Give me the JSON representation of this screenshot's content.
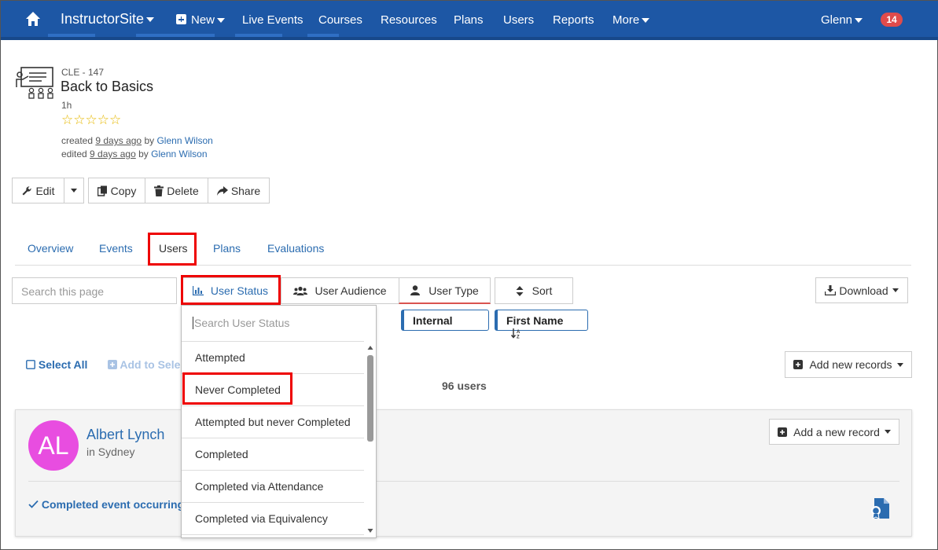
{
  "nav": {
    "brand": "InstructorSite",
    "new": "New",
    "items": [
      "Live Events",
      "Courses",
      "Resources",
      "Plans",
      "Users",
      "Reports",
      "More"
    ],
    "user": "Glenn",
    "badge": "14"
  },
  "course": {
    "code": "CLE - 147",
    "title": "Back to Basics",
    "duration": "1h",
    "stars": "☆☆☆☆☆",
    "created_prefix": "created",
    "created_when": "9 days ago",
    "created_by_word": "by",
    "created_by": "Glenn Wilson",
    "edited_prefix": "edited",
    "edited_when": "9 days ago",
    "edited_by_word": "by",
    "edited_by": "Glenn Wilson"
  },
  "actions": {
    "edit": "Edit",
    "copy": "Copy",
    "delete": "Delete",
    "share": "Share"
  },
  "tabs": [
    "Overview",
    "Events",
    "Users",
    "Plans",
    "Evaluations"
  ],
  "filters": {
    "search_placeholder": "Search this page",
    "user_status": "User Status",
    "user_audience": "User Audience",
    "user_type": "User Type",
    "sort": "Sort",
    "download": "Download",
    "chip_internal": "Internal",
    "chip_first_name": "First Name"
  },
  "dropdown": {
    "search_placeholder": "Search User Status",
    "items": [
      "Attempted",
      "Never Completed",
      "Attempted but never Completed",
      "Completed",
      "Completed via Attendance",
      "Completed via Equivalency"
    ]
  },
  "records": {
    "select_all": "Select All",
    "add_to_selection": "Add to Selec",
    "count": "96 users",
    "add_new_records": "Add new records"
  },
  "user_card": {
    "initials": "AL",
    "name": "Albert Lynch",
    "location": "in Sydney",
    "add_record": "Add a new record",
    "status": "Completed event occurring N"
  },
  "colors": {
    "nav": "#1d57a5",
    "accent": "#2b6cb0",
    "highlight": "#e00000",
    "avatar": "#e84de0",
    "star": "#e6b800"
  }
}
